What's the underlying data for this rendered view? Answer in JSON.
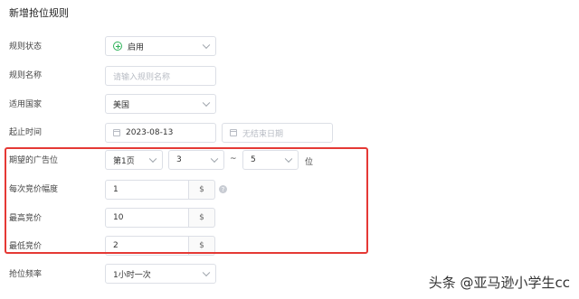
{
  "page": {
    "title": "新增抢位规则"
  },
  "form": {
    "status": {
      "label": "规则状态",
      "value": "启用"
    },
    "name": {
      "label": "规则名称",
      "placeholder": "请输入规则名称"
    },
    "country": {
      "label": "适用国家",
      "value": "美国"
    },
    "period": {
      "label": "起止时间",
      "start": "2023-08-13",
      "end_placeholder": "无结束日期"
    },
    "position": {
      "label": "期望的广告位",
      "page": "第1页",
      "from": "3",
      "tilde": "~",
      "to": "5",
      "suffix": "位"
    },
    "increment": {
      "label": "每次竞价幅度",
      "value": "1",
      "unit": "$",
      "help": "?"
    },
    "max_bid": {
      "label": "最高竞价",
      "value": "10",
      "unit": "$"
    },
    "min_bid": {
      "label": "最低竞价",
      "value": "2",
      "unit": "$"
    },
    "frequency": {
      "label": "抢位频率",
      "value": "1小时一次"
    }
  },
  "watermark": "头条 @亚马逊小学生cc",
  "colors": {
    "highlight_border": "#e53935",
    "status_green": "#2fb35a"
  }
}
